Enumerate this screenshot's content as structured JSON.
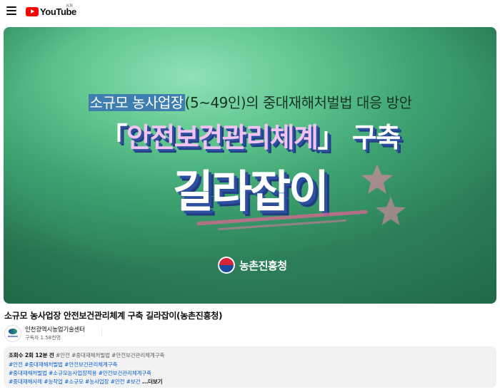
{
  "header": {
    "menu_icon": "hamburger-menu-icon",
    "logo_text": "YouTube",
    "region": "KR"
  },
  "thumbnail": {
    "line1_highlight": "소규모 농사업장",
    "line1_rest": "(5~49인)의 중대재해처벌법 대응 방안",
    "line2_open": "「",
    "line2_accent": "안전보건관리체계",
    "line2_close": "」 구축",
    "line3": "길라잡이",
    "org_name": "농촌진흥청"
  },
  "video": {
    "title": "소규모 농사업장 안전보건관리체계 구축 길라잡이(농촌진흥청)"
  },
  "channel": {
    "name": "인천광역시농업기술센터",
    "subscribers": "구독자 1.58천명"
  },
  "description": {
    "meta": "조회수 2회  12분 전",
    "line1_tags": "#안전 #중대재해처벌법 #안전보건관리체계구축",
    "line2_tags": "#안전 #중대재해처벌법 #안전보건관리체계구축",
    "line3_tags": "#중대재해처벌법 #소규모농사업장적용 #안전보건관리체계구축",
    "line4_tags": "#중대재해사례 #농작업 #소규모 #농사업장 #안전 #보건",
    "more_label": "...더보기"
  },
  "colors": {
    "brand_red": "#ff0000",
    "link_blue": "#065fd4",
    "thumb_green": "#3da270"
  }
}
